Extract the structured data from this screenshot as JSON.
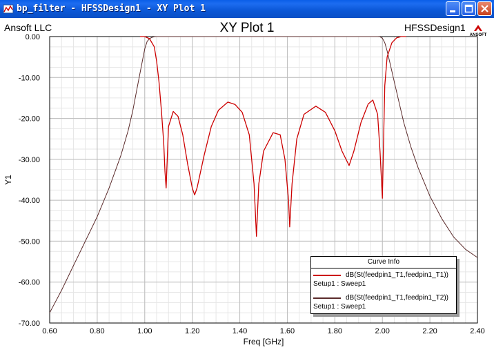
{
  "window": {
    "title": "bp_filter - HFSSDesign1 - XY Plot 1",
    "buttons": [
      "minimize",
      "maximize",
      "close"
    ]
  },
  "header": {
    "company": "Ansoft LLC",
    "plot_title": "XY Plot 1",
    "design": "HFSSDesign1",
    "logo_text": "ANSOFT"
  },
  "legend": {
    "title": "Curve Info",
    "entries": [
      {
        "name": "dB(St(feedpin1_T1,feedpin1_T1))",
        "setup": "Setup1 : Sweep1",
        "color": "#cc0000"
      },
      {
        "name": "dB(St(feedpin1_T1,feedpin1_T2))",
        "setup": "Setup1 : Sweep1",
        "color": "#5a2a2a"
      }
    ]
  },
  "chart_data": {
    "type": "line",
    "title": "XY Plot 1",
    "xlabel": "Freq [GHz]",
    "ylabel": "Y1",
    "xlim": [
      0.6,
      2.4
    ],
    "ylim": [
      -70,
      0
    ],
    "xticks": [
      "0.60",
      "0.80",
      "1.00",
      "1.20",
      "1.40",
      "1.60",
      "1.80",
      "2.00",
      "2.20",
      "2.40"
    ],
    "yticks": [
      "0.00",
      "-10.00",
      "-20.00",
      "-30.00",
      "-40.00",
      "-50.00",
      "-60.00",
      "-70.00"
    ],
    "grid": true,
    "legend_position": "bottom-right",
    "series": [
      {
        "name": "dB(St(feedpin1_T1,feedpin1_T1))",
        "color": "#cc0000",
        "x": [
          0.98,
          1.0,
          1.02,
          1.04,
          1.05,
          1.06,
          1.07,
          1.08,
          1.085,
          1.09,
          1.1,
          1.12,
          1.14,
          1.16,
          1.18,
          1.2,
          1.21,
          1.22,
          1.25,
          1.28,
          1.31,
          1.35,
          1.38,
          1.41,
          1.44,
          1.46,
          1.47,
          1.48,
          1.5,
          1.54,
          1.57,
          1.59,
          1.605,
          1.61,
          1.62,
          1.64,
          1.67,
          1.72,
          1.76,
          1.8,
          1.83,
          1.86,
          1.88,
          1.91,
          1.94,
          1.96,
          1.98,
          1.99,
          2.0,
          2.005,
          2.01,
          2.02,
          2.04,
          2.06,
          2.08,
          2.1
        ],
        "y": [
          0,
          0,
          -0.5,
          -2.5,
          -6,
          -11,
          -18,
          -26,
          -33,
          -37,
          -22,
          -18.3,
          -19.5,
          -24,
          -31,
          -37,
          -38.7,
          -37,
          -29,
          -22,
          -18,
          -16,
          -16.6,
          -18.5,
          -24,
          -36,
          -48.8,
          -36,
          -28,
          -23.5,
          -24,
          -30,
          -40,
          -46.5,
          -36,
          -25,
          -19,
          -17,
          -18.5,
          -23,
          -28,
          -31.5,
          -28,
          -21,
          -16.5,
          -15.5,
          -19,
          -28,
          -39.5,
          -26,
          -12,
          -5,
          -1.5,
          -0.3,
          0,
          0
        ]
      },
      {
        "name": "dB(St(feedpin1_T1,feedpin1_T2))",
        "color": "#5a2a2a",
        "x": [
          0.6,
          0.65,
          0.7,
          0.75,
          0.8,
          0.85,
          0.9,
          0.93,
          0.95,
          0.97,
          0.99,
          1.0,
          1.01,
          1.02,
          1.03,
          1.04,
          1.05,
          1.07,
          1.1,
          1.95,
          1.98,
          1.99,
          2.0,
          2.01,
          2.02,
          2.03,
          2.05,
          2.07,
          2.09,
          2.12,
          2.15,
          2.2,
          2.25,
          2.3,
          2.35,
          2.4
        ],
        "y": [
          -67.5,
          -62,
          -56,
          -50,
          -44,
          -37,
          -29,
          -23,
          -18,
          -12,
          -6,
          -3,
          -1.2,
          -0.5,
          -0.2,
          -0.05,
          0,
          0,
          0,
          0,
          0,
          -0.05,
          -0.4,
          -1.5,
          -3.5,
          -6,
          -11,
          -16,
          -21,
          -27,
          -32,
          -39,
          -44.5,
          -49,
          -52,
          -54
        ]
      }
    ]
  }
}
